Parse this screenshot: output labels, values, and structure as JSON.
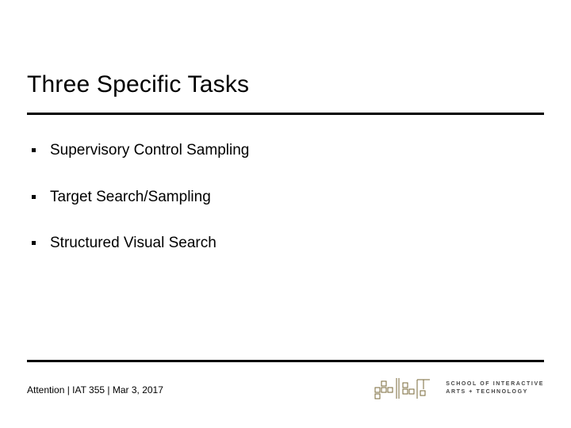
{
  "title": "Three Specific Tasks",
  "bullets": [
    "Supervisory Control Sampling",
    "Target Search/Sampling",
    "Structured Visual Search"
  ],
  "footer": "Attention | IAT 355  |  Mar 3, 2017",
  "logo": {
    "line1": "School of Interactive",
    "line2": "Arts + Technology"
  }
}
